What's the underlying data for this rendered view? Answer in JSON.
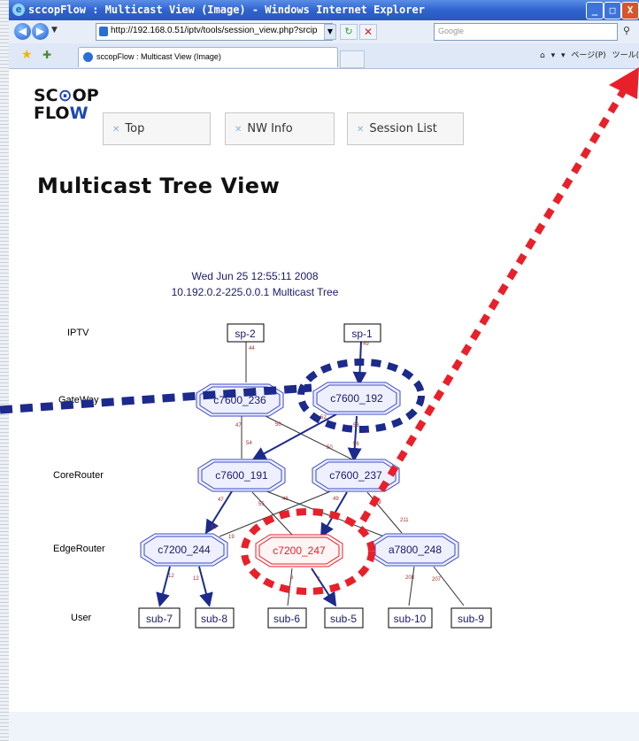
{
  "window": {
    "title": "sccopFlow : Multicast View (Image) - Windows Internet Explorer",
    "controls": {
      "minimize": "_",
      "maximize": "□",
      "close": "X"
    }
  },
  "addressbar": {
    "url": "http://192.168.0.51/iptv/tools/session_view.php?srcip",
    "search_placeholder": "Google"
  },
  "tabs": [
    {
      "label": "sccopFlow : Multicast View (Image)"
    }
  ],
  "command_bar": {
    "home": "⌂",
    "feeds": "▾",
    "print": "▾",
    "page": "ページ(P)",
    "tools": "ツール(O)"
  },
  "site": {
    "logo_line1": "SC",
    "logo_line1b": "OP",
    "logo_line2a": "FLO",
    "logo_line2b": "W",
    "nav": [
      "Top",
      "NW Info",
      "Session List"
    ],
    "page_title": "Multicast Tree View"
  },
  "tree": {
    "timestamp": "Wed Jun 25 12:55:11 2008",
    "subtitle": "10.192.0.2-225.0.0.1 Multicast Tree",
    "levels": [
      "IPTV",
      "GateWay",
      "CoreRouter",
      "EdgeRouter",
      "User"
    ],
    "nodes": {
      "sp2": "sp-2",
      "sp1": "sp-1",
      "gw236": "c7600_236",
      "gw192": "c7600_192",
      "cr191": "c7600_191",
      "cr237": "c7600_237",
      "er244": "c7200_244",
      "er247": "c7200_247",
      "er248": "a7800_248",
      "sub7": "sub-7",
      "sub8": "sub-8",
      "sub6": "sub-6",
      "sub5": "sub-5",
      "sub10": "sub-10",
      "sub9": "sub-9"
    },
    "edge_labels": [
      "44",
      "49",
      "47",
      "50",
      "52",
      "53",
      "54",
      "50",
      "56",
      "47",
      "55",
      "46",
      "40",
      "49",
      "39",
      "211",
      "51",
      "19",
      "12",
      "12",
      "6",
      "7",
      "208",
      "207"
    ]
  },
  "colors": {
    "highlight_red": "#e8202a",
    "annotation_blue": "#1c2a8c",
    "node_fill": "#eef0ff",
    "node_stroke": "#3a48c8"
  }
}
